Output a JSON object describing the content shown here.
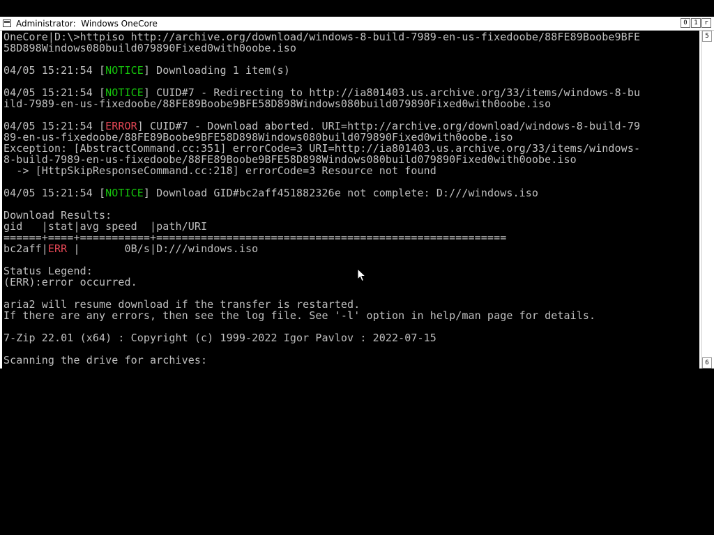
{
  "window": {
    "title": "Administrator:  Windows OneCore",
    "buttons": {
      "minimize": "0",
      "maximize": "1",
      "close": "r"
    },
    "scroll_up_glyph": "5",
    "scroll_down_glyph": "6"
  },
  "colors": {
    "notice": "#16c60c",
    "error": "#e74856",
    "text": "#c0c0c0",
    "background": "#000000"
  },
  "console": {
    "lines": [
      {
        "type": "plain",
        "text": "OneCore|D:\\>httpiso http://archive.org/download/windows-8-build-7989-en-us-fixedoobe/88FE89Boobe9BFE"
      },
      {
        "type": "plain",
        "text": "58D898Windows080build079890Fixed0with0oobe.iso"
      },
      {
        "type": "plain",
        "text": ""
      },
      {
        "type": "tagged",
        "prefix": "04/05 15:21:54 [",
        "tag": "NOTICE",
        "tag_class": "notice",
        "suffix": "] Downloading 1 item(s)"
      },
      {
        "type": "plain",
        "text": ""
      },
      {
        "type": "tagged",
        "prefix": "04/05 15:21:54 [",
        "tag": "NOTICE",
        "tag_class": "notice",
        "suffix": "] CUID#7 - Redirecting to http://ia801403.us.archive.org/33/items/windows-8-bu"
      },
      {
        "type": "plain",
        "text": "ild-7989-en-us-fixedoobe/88FE89Boobe9BFE58D898Windows080build079890Fixed0with0oobe.iso"
      },
      {
        "type": "plain",
        "text": ""
      },
      {
        "type": "tagged",
        "prefix": "04/05 15:21:54 [",
        "tag": "ERROR",
        "tag_class": "error",
        "suffix": "] CUID#7 - Download aborted. URI=http://archive.org/download/windows-8-build-79"
      },
      {
        "type": "plain",
        "text": "89-en-us-fixedoobe/88FE89Boobe9BFE58D898Windows080build079890Fixed0with0oobe.iso"
      },
      {
        "type": "plain",
        "text": "Exception: [AbstractCommand.cc:351] errorCode=3 URI=http://ia801403.us.archive.org/33/items/windows-"
      },
      {
        "type": "plain",
        "text": "8-build-7989-en-us-fixedoobe/88FE89Boobe9BFE58D898Windows080build079890Fixed0with0oobe.iso"
      },
      {
        "type": "plain",
        "text": "  -> [HttpSkipResponseCommand.cc:218] errorCode=3 Resource not found"
      },
      {
        "type": "plain",
        "text": ""
      },
      {
        "type": "tagged",
        "prefix": "04/05 15:21:54 [",
        "tag": "NOTICE",
        "tag_class": "notice",
        "suffix": "] Download GID#bc2aff451882326e not complete: D:///windows.iso"
      },
      {
        "type": "plain",
        "text": ""
      },
      {
        "type": "plain",
        "text": "Download Results:"
      },
      {
        "type": "plain",
        "text": "gid   |stat|avg speed  |path/URI"
      },
      {
        "type": "plain",
        "text": "======+====+===========+======================================================="
      },
      {
        "type": "tagged",
        "prefix": "bc2aff|",
        "tag": "ERR ",
        "tag_class": "error",
        "suffix": "|       0B/s|D:///windows.iso"
      },
      {
        "type": "plain",
        "text": ""
      },
      {
        "type": "plain",
        "text": "Status Legend:"
      },
      {
        "type": "plain",
        "text": "(ERR):error occurred."
      },
      {
        "type": "plain",
        "text": ""
      },
      {
        "type": "plain",
        "text": "aria2 will resume download if the transfer is restarted."
      },
      {
        "type": "plain",
        "text": "If there are any errors, then see the log file. See '-l' option in help/man page for details."
      },
      {
        "type": "plain",
        "text": ""
      },
      {
        "type": "plain",
        "text": "7-Zip 22.01 (x64) : Copyright (c) 1999-2022 Igor Pavlov : 2022-07-15"
      },
      {
        "type": "plain",
        "text": ""
      },
      {
        "type": "plain",
        "text": "Scanning the drive for archives:"
      },
      {
        "type": "plain",
        "text": ""
      }
    ]
  }
}
